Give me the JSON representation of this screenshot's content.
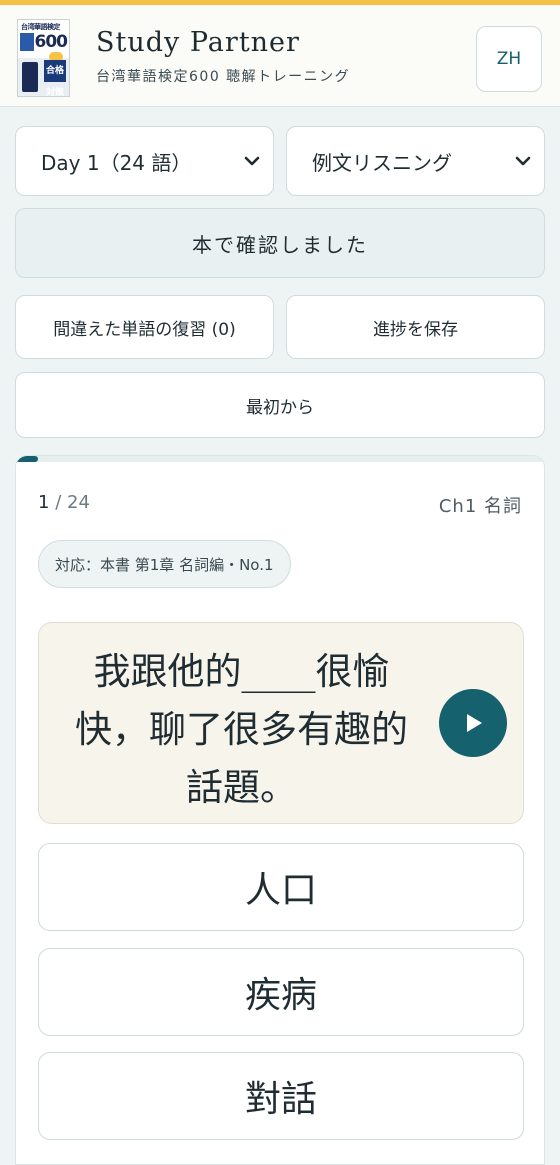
{
  "header": {
    "book_cover": {
      "title": "台湾華語検定",
      "number": "600",
      "tag": "合格対策"
    },
    "title": "Study Partner",
    "subtitle": "台湾華語検定600 聴解トレーニング",
    "language_button": "ZH"
  },
  "controls": {
    "day_select": {
      "selected": "Day 1（24 語）"
    },
    "mode_select": {
      "selected": "例文リスニング"
    },
    "confirm_button": "本で確認しました",
    "review_button": "間違えた単語の復習 (0)",
    "save_button": "進捗を保存",
    "restart_button": "最初から"
  },
  "card": {
    "progress_fraction": 0.0417,
    "current": "1",
    "separator": "/",
    "total": "24",
    "chapter": "Ch1 名詞",
    "reference": "対応：本書 第1章 名詞編・No.1",
    "sentence": "我跟他的____很愉快，聊了很多有趣的話題。",
    "choices": [
      "人口",
      "疾病",
      "對話"
    ]
  },
  "colors": {
    "accent": "#15616d",
    "top_bar": "#f5c246",
    "background": "#eef4f4"
  }
}
